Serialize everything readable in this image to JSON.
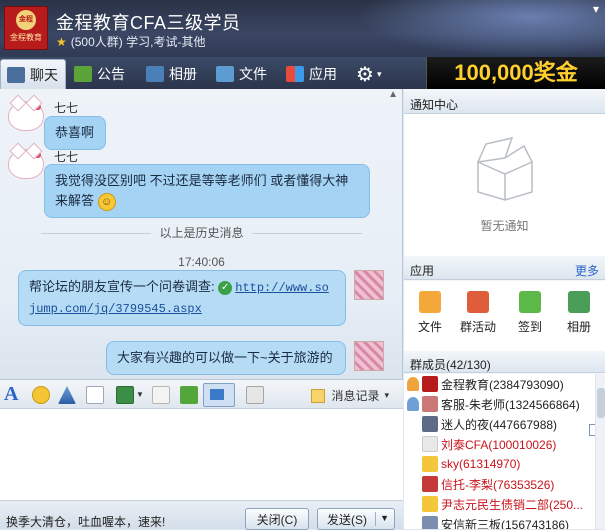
{
  "window": {
    "group_name": "金程教育CFA三级学员",
    "group_info": "(500人群) 学习,考试-其他",
    "logo_text": "金程教育"
  },
  "toolbar": {
    "tabs": [
      {
        "label": "聊天",
        "icon": "chat-icon"
      },
      {
        "label": "公告",
        "icon": "megaphone-icon"
      },
      {
        "label": "相册",
        "icon": "album-icon"
      },
      {
        "label": "文件",
        "icon": "folder-icon"
      },
      {
        "label": "应用",
        "icon": "apps-icon"
      }
    ],
    "settings_icon": "gear-icon",
    "promo": "100,000奖金"
  },
  "chat": {
    "messages": [
      {
        "sender": "七七",
        "text": "恭喜啊"
      },
      {
        "sender": "七七",
        "text_line1": "我觉得没区别吧  不过还是等等老师们  或者懂得大神",
        "text_line2": "来解答"
      }
    ],
    "history_divider": "以上是历史消息",
    "time": "17:40:06",
    "outgoing": [
      {
        "text": "帮论坛的朋友宣传一个问卷调查:",
        "link_line1": "http://www.so",
        "link_line2": "jump.com/jq/3799545.aspx"
      },
      {
        "text": "大家有兴趣的可以做一下~关于旅游的"
      }
    ]
  },
  "input_tools": {
    "history_label": "消息记录"
  },
  "bottom": {
    "ad_text": "换季大清仓，吐血喔本，速来!",
    "close_label": "关闭(C)",
    "send_label": "发送(S)"
  },
  "notice": {
    "header": "通知中心",
    "empty_text": "暂无通知"
  },
  "apps": {
    "header": "应用",
    "more": "更多",
    "items": [
      "文件",
      "群活动",
      "签到",
      "相册"
    ]
  },
  "members": {
    "header": "群成员(42/130)",
    "list": [
      {
        "name": "金程教育(2384793090)",
        "red": false,
        "role_color": "#f0a33a"
      },
      {
        "name": "客服-朱老师(1324566864)",
        "red": false,
        "role_color": "#6fa0d8"
      },
      {
        "name": "迷人的夜(447667988)",
        "red": false,
        "role_color": ""
      },
      {
        "name": "刘泰CFA(100010026)",
        "red": true,
        "role_color": ""
      },
      {
        "name": "sky(61314970)",
        "red": true,
        "role_color": ""
      },
      {
        "name": "信托-李梨(76353526)",
        "red": true,
        "role_color": ""
      },
      {
        "name": "尹志元民生债销二部(250...",
        "red": true,
        "role_color": ""
      },
      {
        "name": "安信新三板(156743186)",
        "red": false,
        "role_color": ""
      }
    ]
  }
}
